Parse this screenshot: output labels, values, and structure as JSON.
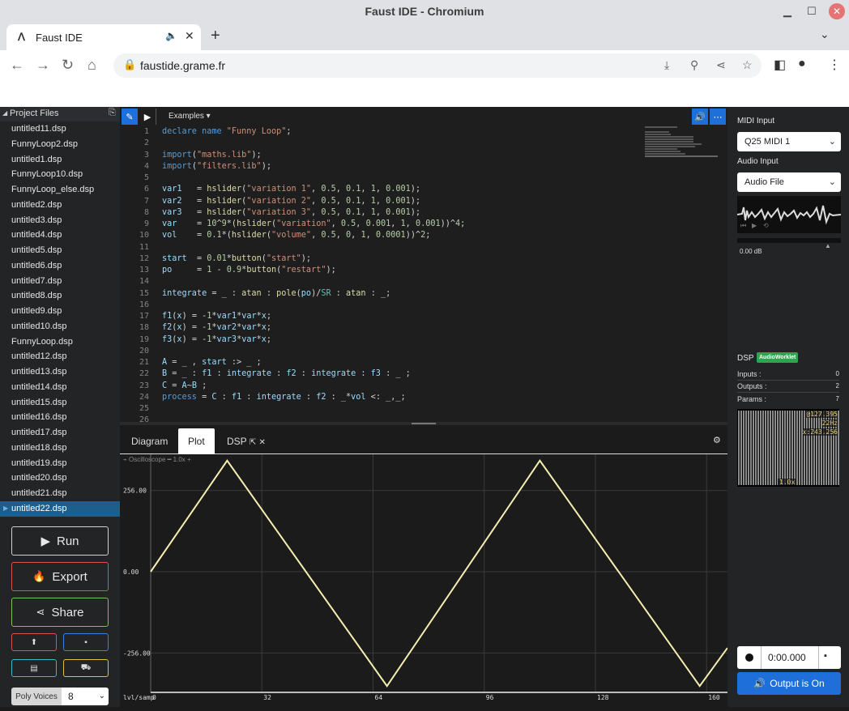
{
  "window": {
    "title": "Faust IDE - Chromium"
  },
  "tab": {
    "title": "Faust IDE"
  },
  "address": {
    "url": "faustide.grame.fr"
  },
  "sidebar": {
    "header": "Project Files",
    "files": [
      "untitled11.dsp",
      "FunnyLoop2.dsp",
      "untitled1.dsp",
      "FunnyLoop10.dsp",
      "FunnyLoop_else.dsp",
      "untitled2.dsp",
      "untitled3.dsp",
      "untitled4.dsp",
      "untitled5.dsp",
      "untitled6.dsp",
      "untitled7.dsp",
      "untitled8.dsp",
      "untitled9.dsp",
      "untitled10.dsp",
      "FunnyLoop.dsp",
      "untitled12.dsp",
      "untitled13.dsp",
      "untitled14.dsp",
      "untitled15.dsp",
      "untitled16.dsp",
      "untitled17.dsp",
      "untitled18.dsp",
      "untitled19.dsp",
      "untitled20.dsp",
      "untitled21.dsp",
      "untitled22.dsp"
    ],
    "active_file": "untitled22.dsp",
    "run_label": "Run",
    "export_label": "Export",
    "share_label": "Share",
    "poly_label": "Poly Voices",
    "poly_value": "8"
  },
  "editor": {
    "examples_label": "Examples",
    "line_numbers": [
      "1",
      "2",
      "3",
      "4",
      "5",
      "6",
      "7",
      "8",
      "9",
      "10",
      "11",
      "12",
      "13",
      "14",
      "15",
      "16",
      "17",
      "18",
      "19",
      "20",
      "21",
      "22",
      "23",
      "24",
      "25",
      "26"
    ]
  },
  "bottom": {
    "tabs": [
      "Diagram",
      "Plot",
      "DSP"
    ],
    "active_tab": "Plot",
    "scope_label": "Oscilloscope",
    "scope_zoom": "1.0x",
    "y_ticks": [
      "256.00",
      "0.00",
      "-256.00"
    ],
    "x_ticks": [
      "0",
      "32",
      "64",
      "96",
      "128",
      "160"
    ],
    "x_axis_label": "lvl/samp"
  },
  "right": {
    "midi_label": "MIDI Input",
    "midi_value": "Q25 MIDI 1",
    "audio_label": "Audio Input",
    "audio_value": "Audio File",
    "db_text": "0.00 dB",
    "dsp_label": "DSP",
    "dsp_badge": "AudioWorklet",
    "inputs_label": "Inputs :",
    "inputs_value": "0",
    "outputs_label": "Outputs :",
    "outputs_value": "2",
    "params_label": "Params :",
    "params_value": "7",
    "scope_values": [
      "@127.395",
      "22Hz",
      "x:243.256"
    ],
    "scope_zoom": "1.0x",
    "rec_time": "0:00.000",
    "output_label": "Output is On"
  },
  "chart_data": {
    "type": "line",
    "x": [
      0,
      22,
      68,
      112,
      158,
      166
    ],
    "y": [
      0,
      350,
      -360,
      350,
      -360,
      -240
    ],
    "xlim": [
      0,
      166
    ],
    "ylim": [
      -380,
      370
    ],
    "x_ticks": [
      0,
      32,
      64,
      96,
      128,
      160
    ],
    "y_ticks": [
      256,
      0,
      -256
    ],
    "colors": {
      "line": "#f5eeb0",
      "grid": "#3a3a3a"
    }
  }
}
